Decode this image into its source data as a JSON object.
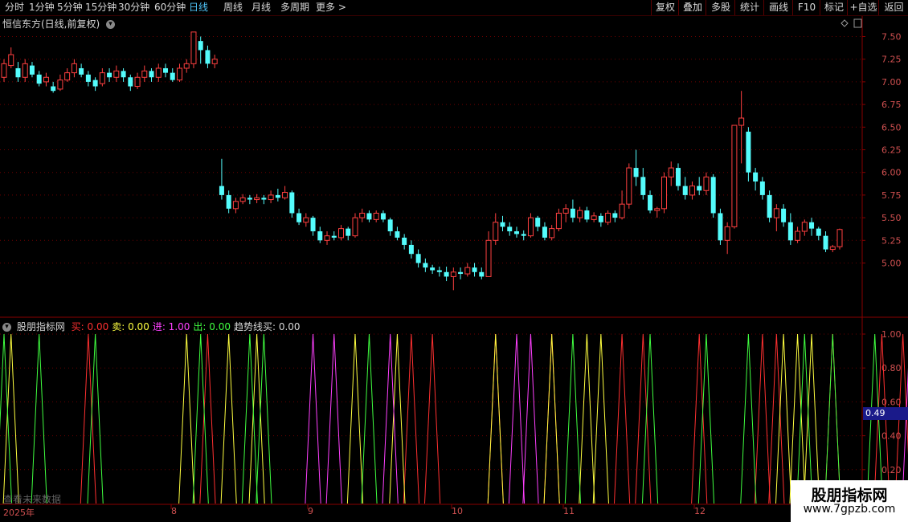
{
  "toolbar": {
    "left": [
      "分时",
      "1分钟",
      "5分钟",
      "15分钟",
      "30分钟",
      "60分钟",
      "日线",
      "周线",
      "月线",
      "多周期",
      "更多 >"
    ],
    "active_index": 6,
    "right": [
      "复权",
      "叠加",
      "多股",
      "统计",
      "画线",
      "F10",
      "标记",
      "+自选",
      "返回"
    ]
  },
  "main_chart": {
    "title": "恒信东方(日线,前复权)",
    "y_ticks": [
      "7.50",
      "7.25",
      "7.00",
      "6.75",
      "6.50",
      "6.25",
      "6.00",
      "5.75",
      "5.50",
      "5.25",
      "5.00"
    ],
    "colors": {
      "up": "#ff4040",
      "down": "#54fcfc",
      "grid": "#6a0000"
    }
  },
  "indicator": {
    "name": "股朋指标网",
    "items": [
      {
        "label": "买:",
        "value": "0.00",
        "color": "#ff3030"
      },
      {
        "label": "卖:",
        "value": "0.00",
        "color": "#ffff40"
      },
      {
        "label": "进:",
        "value": "1.00",
        "color": "#ff40ff"
      },
      {
        "label": "出:",
        "value": "0.00",
        "color": "#40ff40"
      },
      {
        "label": "趋势线买:",
        "value": "0.00",
        "color": "#d8d8d8"
      }
    ],
    "y_ticks": [
      "1.00",
      "0.80",
      "0.60",
      "0.40",
      "0.20"
    ],
    "current_value": "0.49"
  },
  "x_axis": {
    "labels": [
      "2025年",
      "8",
      "9",
      "10",
      "11",
      "12"
    ]
  },
  "future_label": "查看未来数据",
  "watermark": {
    "title": "股朋指标网",
    "url": "www.7gpzb.com"
  },
  "chart_data": {
    "type": "candlestick",
    "title": "恒信东方(日线,前复权)",
    "ylim": [
      4.75,
      7.6
    ],
    "candles": [
      [
        7.05,
        7.2,
        7.0,
        7.25
      ],
      [
        7.18,
        7.3,
        7.15,
        7.38
      ],
      [
        7.15,
        7.05,
        7.0,
        7.22
      ],
      [
        7.05,
        7.2,
        7.0,
        7.25
      ],
      [
        7.18,
        7.08,
        7.05,
        7.22
      ],
      [
        7.08,
        6.98,
        6.95,
        7.12
      ],
      [
        7.0,
        7.05,
        6.95,
        7.1
      ],
      [
        6.95,
        6.9,
        6.88,
        7.0
      ],
      [
        6.92,
        7.02,
        6.9,
        7.08
      ],
      [
        7.02,
        7.1,
        7.0,
        7.15
      ],
      [
        7.1,
        7.2,
        7.05,
        7.25
      ],
      [
        7.15,
        7.08,
        7.05,
        7.2
      ],
      [
        7.08,
        7.0,
        6.95,
        7.12
      ],
      [
        7.02,
        6.95,
        6.9,
        7.05
      ],
      [
        6.98,
        7.1,
        6.95,
        7.15
      ],
      [
        7.1,
        7.05,
        7.0,
        7.15
      ],
      [
        7.05,
        7.12,
        7.0,
        7.18
      ],
      [
        7.12,
        7.05,
        7.0,
        7.15
      ],
      [
        7.05,
        6.95,
        6.9,
        7.08
      ],
      [
        6.95,
        7.05,
        6.92,
        7.1
      ],
      [
        7.05,
        7.12,
        7.0,
        7.18
      ],
      [
        7.12,
        7.05,
        7.0,
        7.15
      ],
      [
        7.05,
        7.15,
        7.0,
        7.2
      ],
      [
        7.15,
        7.1,
        7.05,
        7.2
      ],
      [
        7.1,
        7.02,
        7.0,
        7.15
      ],
      [
        7.02,
        7.15,
        7.0,
        7.2
      ],
      [
        7.15,
        7.2,
        7.1,
        7.25
      ],
      [
        7.2,
        7.55,
        7.15,
        7.55
      ],
      [
        7.45,
        7.35,
        7.2,
        7.5
      ],
      [
        7.35,
        7.2,
        7.15,
        7.4
      ],
      [
        7.2,
        7.25,
        7.15,
        7.3
      ],
      [
        5.85,
        5.75,
        5.7,
        6.15
      ],
      [
        5.75,
        5.6,
        5.55,
        5.8
      ],
      [
        5.6,
        5.68,
        5.55,
        5.72
      ],
      [
        5.68,
        5.72,
        5.65,
        5.76
      ],
      [
        5.72,
        5.7,
        5.65,
        5.75
      ],
      [
        5.7,
        5.72,
        5.66,
        5.76
      ],
      [
        5.72,
        5.7,
        5.65,
        5.75
      ],
      [
        5.7,
        5.75,
        5.66,
        5.8
      ],
      [
        5.75,
        5.72,
        5.68,
        5.82
      ],
      [
        5.72,
        5.78,
        5.7,
        5.85
      ],
      [
        5.78,
        5.55,
        5.5,
        5.8
      ],
      [
        5.55,
        5.45,
        5.42,
        5.6
      ],
      [
        5.45,
        5.5,
        5.4,
        5.55
      ],
      [
        5.5,
        5.35,
        5.3,
        5.52
      ],
      [
        5.35,
        5.25,
        5.22,
        5.4
      ],
      [
        5.25,
        5.3,
        5.2,
        5.35
      ],
      [
        5.3,
        5.28,
        5.25,
        5.35
      ],
      [
        5.28,
        5.38,
        5.25,
        5.42
      ],
      [
        5.38,
        5.3,
        5.25,
        5.4
      ],
      [
        5.3,
        5.5,
        5.28,
        5.55
      ],
      [
        5.5,
        5.55,
        5.45,
        5.6
      ],
      [
        5.55,
        5.48,
        5.45,
        5.58
      ],
      [
        5.48,
        5.55,
        5.45,
        5.58
      ],
      [
        5.55,
        5.48,
        5.45,
        5.58
      ],
      [
        5.48,
        5.35,
        5.3,
        5.5
      ],
      [
        5.35,
        5.28,
        5.25,
        5.4
      ],
      [
        5.28,
        5.2,
        5.15,
        5.32
      ],
      [
        5.2,
        5.1,
        5.05,
        5.25
      ],
      [
        5.1,
        5.0,
        4.95,
        5.15
      ],
      [
        5.0,
        4.95,
        4.9,
        5.05
      ],
      [
        4.95,
        4.92,
        4.88,
        4.98
      ],
      [
        4.92,
        4.9,
        4.85,
        4.96
      ],
      [
        4.9,
        4.85,
        4.8,
        4.96
      ],
      [
        4.85,
        4.9,
        4.7,
        4.95
      ],
      [
        4.9,
        4.88,
        4.82,
        4.95
      ],
      [
        4.88,
        4.95,
        4.85,
        5.0
      ],
      [
        4.95,
        4.9,
        4.85,
        5.0
      ],
      [
        4.9,
        4.85,
        4.82,
        4.95
      ],
      [
        4.85,
        5.25,
        4.85,
        5.35
      ],
      [
        5.25,
        5.45,
        5.2,
        5.55
      ],
      [
        5.45,
        5.4,
        5.35,
        5.52
      ],
      [
        5.4,
        5.35,
        5.3,
        5.45
      ],
      [
        5.35,
        5.32,
        5.28,
        5.4
      ],
      [
        5.32,
        5.3,
        5.25,
        5.36
      ],
      [
        5.3,
        5.5,
        5.28,
        5.55
      ],
      [
        5.5,
        5.4,
        5.35,
        5.52
      ],
      [
        5.4,
        5.28,
        5.25,
        5.45
      ],
      [
        5.28,
        5.38,
        5.25,
        5.42
      ],
      [
        5.38,
        5.55,
        5.35,
        5.6
      ],
      [
        5.55,
        5.6,
        5.45,
        5.65
      ],
      [
        5.6,
        5.5,
        5.45,
        5.7
      ],
      [
        5.5,
        5.58,
        5.45,
        5.62
      ],
      [
        5.58,
        5.48,
        5.45,
        5.62
      ],
      [
        5.48,
        5.52,
        5.45,
        5.56
      ],
      [
        5.52,
        5.45,
        5.4,
        5.55
      ],
      [
        5.45,
        5.55,
        5.42,
        5.58
      ],
      [
        5.55,
        5.5,
        5.45,
        5.58
      ],
      [
        5.5,
        5.65,
        5.48,
        5.8
      ],
      [
        5.65,
        6.05,
        5.6,
        6.1
      ],
      [
        6.05,
        5.95,
        5.85,
        6.25
      ],
      [
        5.95,
        5.75,
        5.7,
        6.05
      ],
      [
        5.75,
        5.58,
        5.55,
        5.8
      ],
      [
        5.58,
        5.6,
        5.5,
        5.62
      ],
      [
        5.6,
        5.95,
        5.55,
        6.0
      ],
      [
        5.95,
        6.05,
        5.85,
        6.12
      ],
      [
        6.05,
        5.85,
        5.8,
        6.1
      ],
      [
        5.85,
        5.75,
        5.7,
        5.95
      ],
      [
        5.75,
        5.85,
        5.7,
        5.9
      ],
      [
        5.85,
        5.8,
        5.75,
        5.95
      ],
      [
        5.8,
        5.95,
        5.75,
        6.0
      ],
      [
        5.95,
        5.55,
        5.5,
        5.98
      ],
      [
        5.55,
        5.25,
        5.2,
        5.6
      ],
      [
        5.25,
        5.4,
        5.1,
        5.45
      ],
      [
        5.4,
        6.52,
        5.38,
        6.52
      ],
      [
        6.52,
        6.6,
        6.1,
        6.9
      ],
      [
        6.45,
        6.0,
        5.9,
        6.5
      ],
      [
        6.0,
        5.9,
        5.8,
        6.05
      ],
      [
        5.9,
        5.75,
        5.7,
        5.95
      ],
      [
        5.75,
        5.5,
        5.45,
        5.8
      ],
      [
        5.5,
        5.6,
        5.35,
        5.65
      ],
      [
        5.6,
        5.45,
        5.4,
        5.65
      ],
      [
        5.45,
        5.25,
        5.2,
        5.55
      ],
      [
        5.25,
        5.35,
        5.22,
        5.4
      ],
      [
        5.35,
        5.45,
        5.3,
        5.48
      ],
      [
        5.45,
        5.38,
        5.3,
        5.5
      ],
      [
        5.38,
        5.3,
        5.25,
        5.4
      ],
      [
        5.3,
        5.15,
        5.12,
        5.35
      ],
      [
        5.15,
        5.18,
        5.12,
        5.2
      ],
      [
        5.18,
        5.37,
        5.15,
        5.38
      ]
    ],
    "indicator_series": [
      {
        "name": "买",
        "color": "#ff3030",
        "peaks": [
          12,
          29,
          58,
          61,
          70,
          78,
          88,
          91,
          99,
          108,
          110,
          118,
          125,
          128
        ]
      },
      {
        "name": "卖",
        "color": "#ffff40",
        "peaks": [
          1,
          26,
          32,
          36,
          50,
          56,
          70,
          78,
          83,
          85,
          111,
          113,
          115
        ]
      },
      {
        "name": "进",
        "color": "#ff40ff",
        "peaks": [
          44,
          47,
          55,
          73,
          75,
          129
        ]
      },
      {
        "name": "出",
        "color": "#40ff40",
        "peaks": [
          0,
          5,
          13,
          28,
          35,
          37,
          52,
          81,
          92,
          100,
          106,
          114,
          118,
          124
        ]
      }
    ]
  }
}
